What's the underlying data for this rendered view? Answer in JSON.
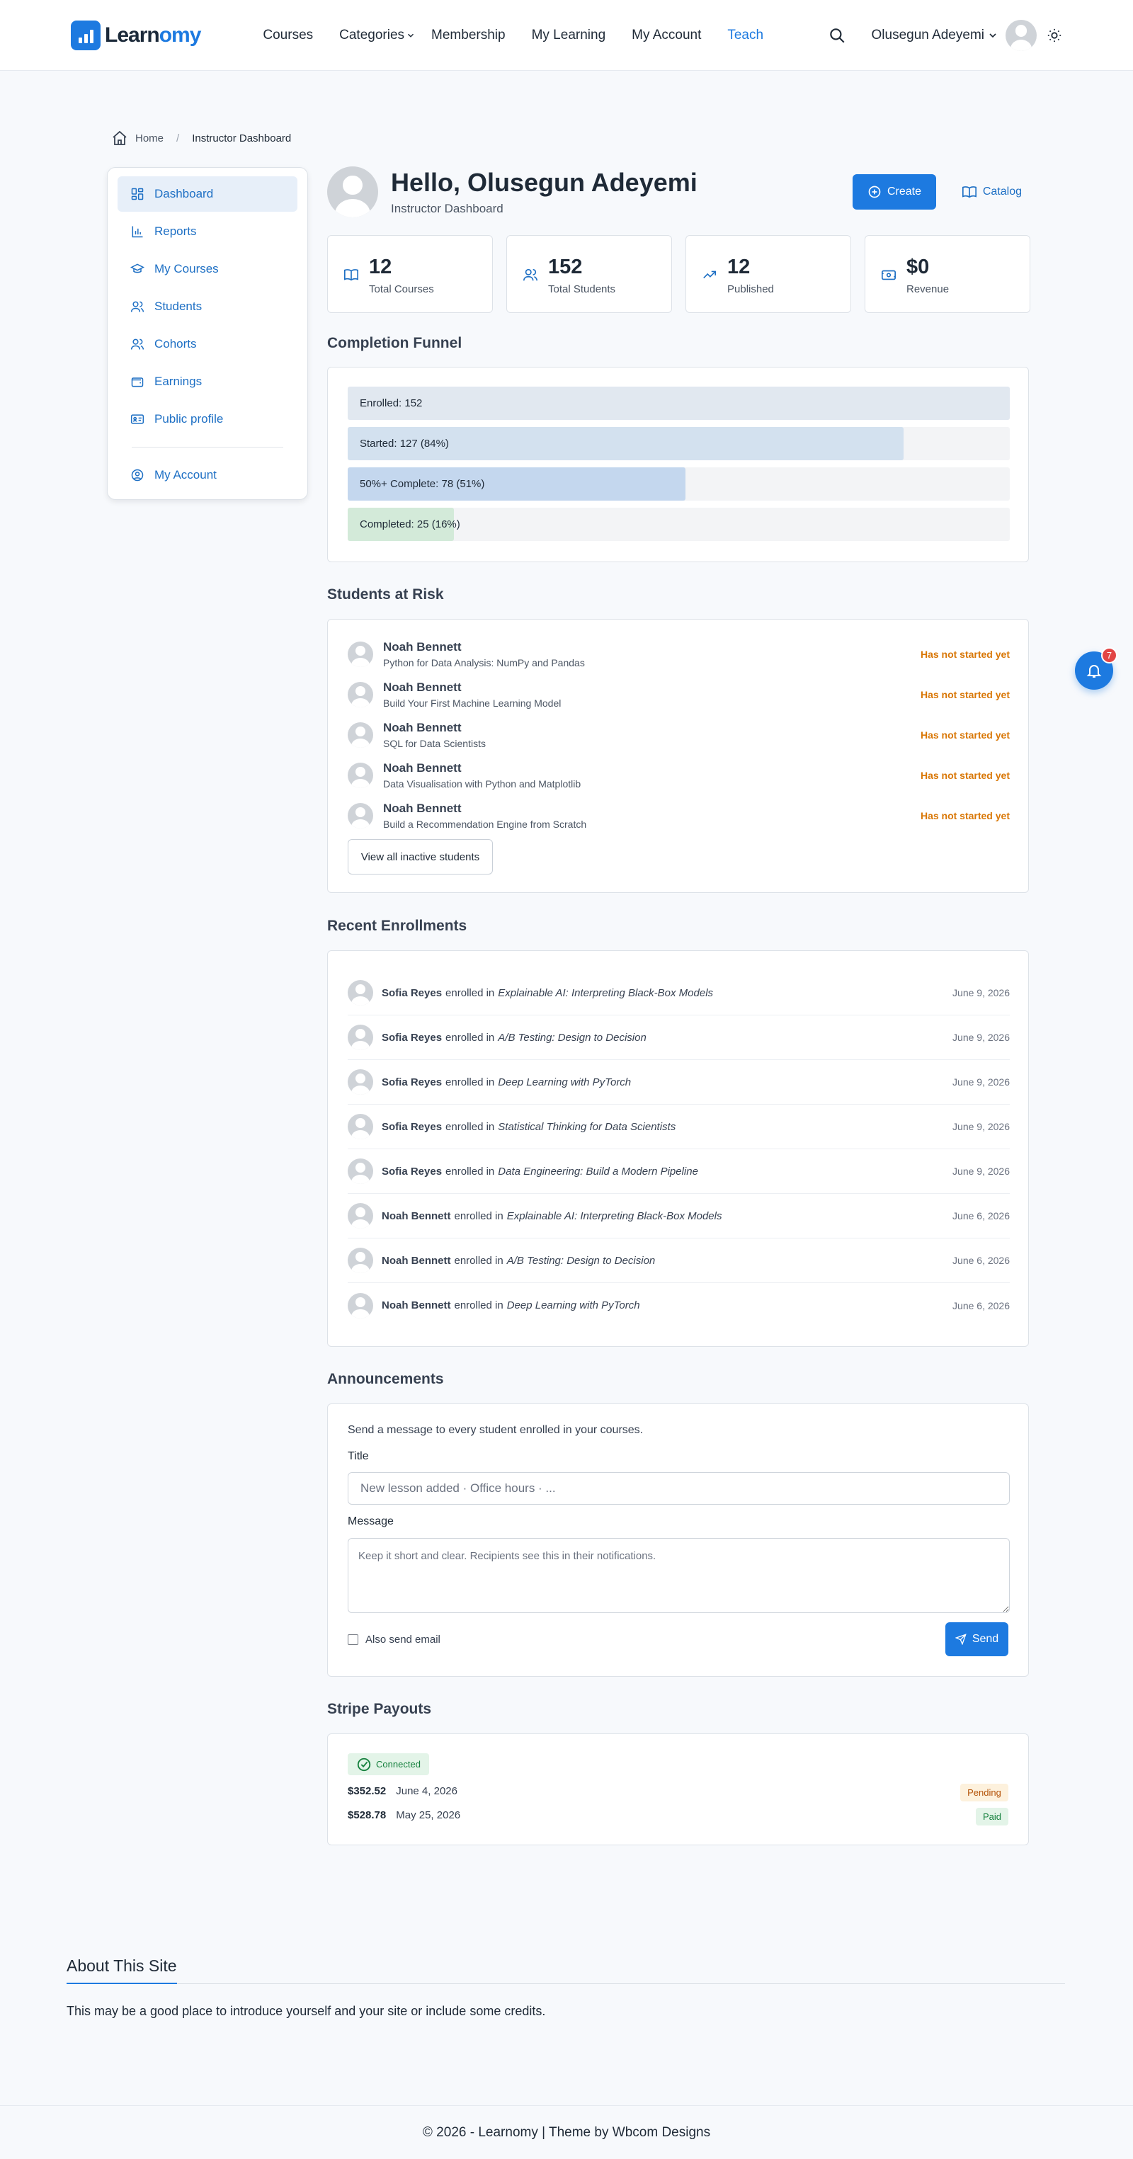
{
  "brand": {
    "name_a": "Learn",
    "name_b": "omy",
    "accent": "#1d7ae0"
  },
  "nav": {
    "courses": "Courses",
    "categories": "Categories",
    "membership": "Membership",
    "my_learning": "My Learning",
    "my_account": "My Account",
    "teach": "Teach"
  },
  "user": {
    "name": "Olusegun Adeyemi"
  },
  "breadcrumb": {
    "home": "Home",
    "sep": "/",
    "current": "Instructor Dashboard"
  },
  "sidebar": {
    "items": [
      {
        "label": "Dashboard",
        "icon": "dashboard-icon"
      },
      {
        "label": "Reports",
        "icon": "bar-chart-icon"
      },
      {
        "label": "My Courses",
        "icon": "graduation-cap-icon"
      },
      {
        "label": "Students",
        "icon": "users-icon"
      },
      {
        "label": "Cohorts",
        "icon": "users-icon"
      },
      {
        "label": "Earnings",
        "icon": "wallet-icon"
      },
      {
        "label": "Public profile",
        "icon": "id-card-icon"
      }
    ],
    "account": "My Account"
  },
  "greeting": {
    "title": "Hello, Olusegun Adeyemi",
    "subtitle": "Instructor Dashboard",
    "create": "Create",
    "catalog": "Catalog"
  },
  "stats": [
    {
      "value": "12",
      "label": "Total Courses",
      "icon": "book-icon"
    },
    {
      "value": "152",
      "label": "Total Students",
      "icon": "users-icon"
    },
    {
      "value": "12",
      "label": "Published",
      "icon": "trending-up-icon"
    },
    {
      "value": "$0",
      "label": "Revenue",
      "icon": "money-icon"
    }
  ],
  "funnel": {
    "title": "Completion Funnel",
    "bars": [
      {
        "label": "Enrolled: 152",
        "fraction": 1.0,
        "color": "#e1e8f0"
      },
      {
        "label": "Started: 127 (84%)",
        "fraction": 0.84,
        "color": "#d3e1ef"
      },
      {
        "label": "50%+ Complete: 78 (51%)",
        "fraction": 0.51,
        "color": "#c4d7ee"
      },
      {
        "label": "Completed: 25 (16%)",
        "fraction": 0.16,
        "color": "#d3ead9"
      }
    ]
  },
  "at_risk": {
    "title": "Students at Risk",
    "rows": [
      {
        "name": "Noah Bennett",
        "course": "Python for Data Analysis: NumPy and Pandas",
        "status": "Has not started yet"
      },
      {
        "name": "Noah Bennett",
        "course": "Build Your First Machine Learning Model",
        "status": "Has not started yet"
      },
      {
        "name": "Noah Bennett",
        "course": "SQL for Data Scientists",
        "status": "Has not started yet"
      },
      {
        "name": "Noah Bennett",
        "course": "Data Visualisation with Python and Matplotlib",
        "status": "Has not started yet"
      },
      {
        "name": "Noah Bennett",
        "course": "Build a Recommendation Engine from Scratch",
        "status": "Has not started yet"
      }
    ],
    "view_all": "View all inactive students"
  },
  "enrollments": {
    "title": "Recent Enrollments",
    "verb": "enrolled in",
    "rows": [
      {
        "name": "Sofia Reyes",
        "course": "Explainable AI: Interpreting Black-Box Models",
        "date": "June 9, 2026"
      },
      {
        "name": "Sofia Reyes",
        "course": "A/B Testing: Design to Decision",
        "date": "June 9, 2026"
      },
      {
        "name": "Sofia Reyes",
        "course": "Deep Learning with PyTorch",
        "date": "June 9, 2026"
      },
      {
        "name": "Sofia Reyes",
        "course": "Statistical Thinking for Data Scientists",
        "date": "June 9, 2026"
      },
      {
        "name": "Sofia Reyes",
        "course": "Data Engineering: Build a Modern Pipeline",
        "date": "June 9, 2026"
      },
      {
        "name": "Noah Bennett",
        "course": "Explainable AI: Interpreting Black-Box Models",
        "date": "June 6, 2026"
      },
      {
        "name": "Noah Bennett",
        "course": "A/B Testing: Design to Decision",
        "date": "June 6, 2026"
      },
      {
        "name": "Noah Bennett",
        "course": "Deep Learning with PyTorch",
        "date": "June 6, 2026"
      }
    ]
  },
  "announcements": {
    "title": "Announcements",
    "intro": "Send a message to every student enrolled in your courses.",
    "title_label": "Title",
    "title_placeholder": "New lesson added · Office hours · ...",
    "title_value": "",
    "message_label": "Message",
    "message_placeholder": "Keep it short and clear. Recipients see this in their notifications.",
    "message_value": "",
    "email_label": "Also send email",
    "send": "Send"
  },
  "stripe": {
    "title": "Stripe Payouts",
    "status": "Connected",
    "payouts": [
      {
        "amount": "$352.52",
        "date": "June 4, 2026",
        "status": "Pending"
      },
      {
        "amount": "$528.78",
        "date": "May 25, 2026",
        "status": "Paid"
      }
    ]
  },
  "notifications": {
    "count": "7"
  },
  "about": {
    "title": "About This Site",
    "text": "This may be a good place to introduce yourself and your site or include some credits."
  },
  "footer": {
    "prefix": "© 2026 - ",
    "site": "Learnomy",
    "mid": " | Theme by ",
    "theme": "Wbcom Designs"
  }
}
